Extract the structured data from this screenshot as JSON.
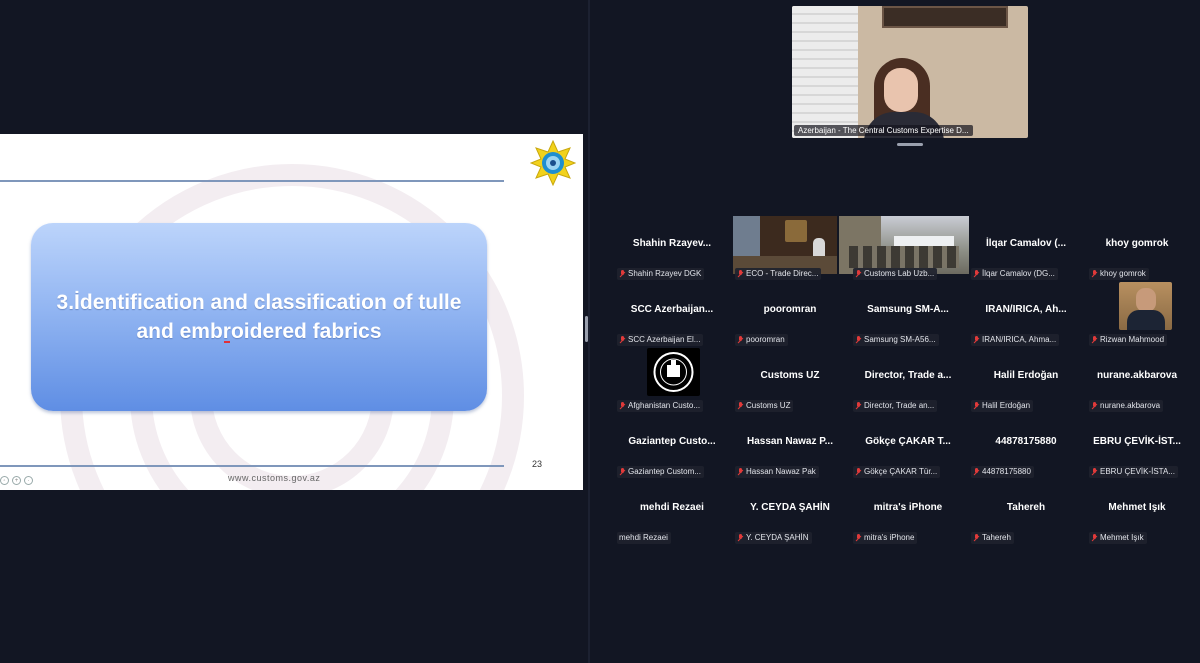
{
  "slide": {
    "title": "3.İdentification and classification of tulle and embroidered fabrics",
    "page_number": "23",
    "url": "www.customs.gov.az"
  },
  "speaker": {
    "name": "Azerbaijan - The Central Customs Expertise D..."
  },
  "participants": [
    {
      "big": "Shahin  Rzayev...",
      "label": "Shahin Rzayev DGK",
      "muted": true
    },
    {
      "big": "",
      "label": "ECO - Trade Direc...",
      "muted": true,
      "video": true
    },
    {
      "big": "",
      "label": "Customs Lab Uzb...",
      "muted": true,
      "video": true
    },
    {
      "big": "İlqar Camalov (...",
      "label": "İlqar Camalov (DG...",
      "muted": true
    },
    {
      "big": "khoy gomrok",
      "label": "khoy gomrok",
      "muted": true
    },
    {
      "big": "SCC  Azerbaijan...",
      "label": "SCC Azerbaijan El...",
      "muted": true
    },
    {
      "big": "pooromran",
      "label": "pooromran",
      "muted": true
    },
    {
      "big": "Samsung  SM-A...",
      "label": "Samsung SM-A56...",
      "muted": true
    },
    {
      "big": "IRAN/IRICA,  Ah...",
      "label": "IRAN/IRICA, Ahma...",
      "muted": true
    },
    {
      "big": "",
      "label": "Rizwan Mahmood",
      "muted": true,
      "avatar": "photo"
    },
    {
      "big": "",
      "label": "Afghanistan Custo...",
      "muted": true,
      "avatar": "emblem"
    },
    {
      "big": "Customs UZ",
      "label": "Customs UZ",
      "muted": true
    },
    {
      "big": "Director,  Trade a...",
      "label": "Director, Trade an...",
      "muted": true
    },
    {
      "big": "Halil Erdoğan",
      "label": "Halil Erdoğan",
      "muted": true
    },
    {
      "big": "nurane.akbarova",
      "label": "nurane.akbarova",
      "muted": true
    },
    {
      "big": "Gaziantep  Custo...",
      "label": "Gaziantep Custom...",
      "muted": true
    },
    {
      "big": "Hassan  Nawaz  P...",
      "label": "Hassan Nawaz Pak",
      "muted": true
    },
    {
      "big": "Gökçe  ÇAKAR  T...",
      "label": "Gökçe ÇAKAR Tür...",
      "muted": true
    },
    {
      "big": "44878175880",
      "label": "44878175880",
      "muted": true
    },
    {
      "big": "EBRU  ÇEVİK-İST...",
      "label": "EBRU ÇEVİK-İSTA...",
      "muted": true
    },
    {
      "big": "mehdi Rezaei",
      "label": "mehdi Rezaei",
      "muted": false
    },
    {
      "big": "Y.  CEYDA  ŞAHİN",
      "label": "Y. CEYDA ŞAHİN",
      "muted": true
    },
    {
      "big": "mitra's iPhone",
      "label": "mitra's iPhone",
      "muted": true
    },
    {
      "big": "Tahereh",
      "label": "Tahereh",
      "muted": true
    },
    {
      "big": "Mehmet Işık",
      "label": "Mehmet Işık",
      "muted": true
    }
  ]
}
